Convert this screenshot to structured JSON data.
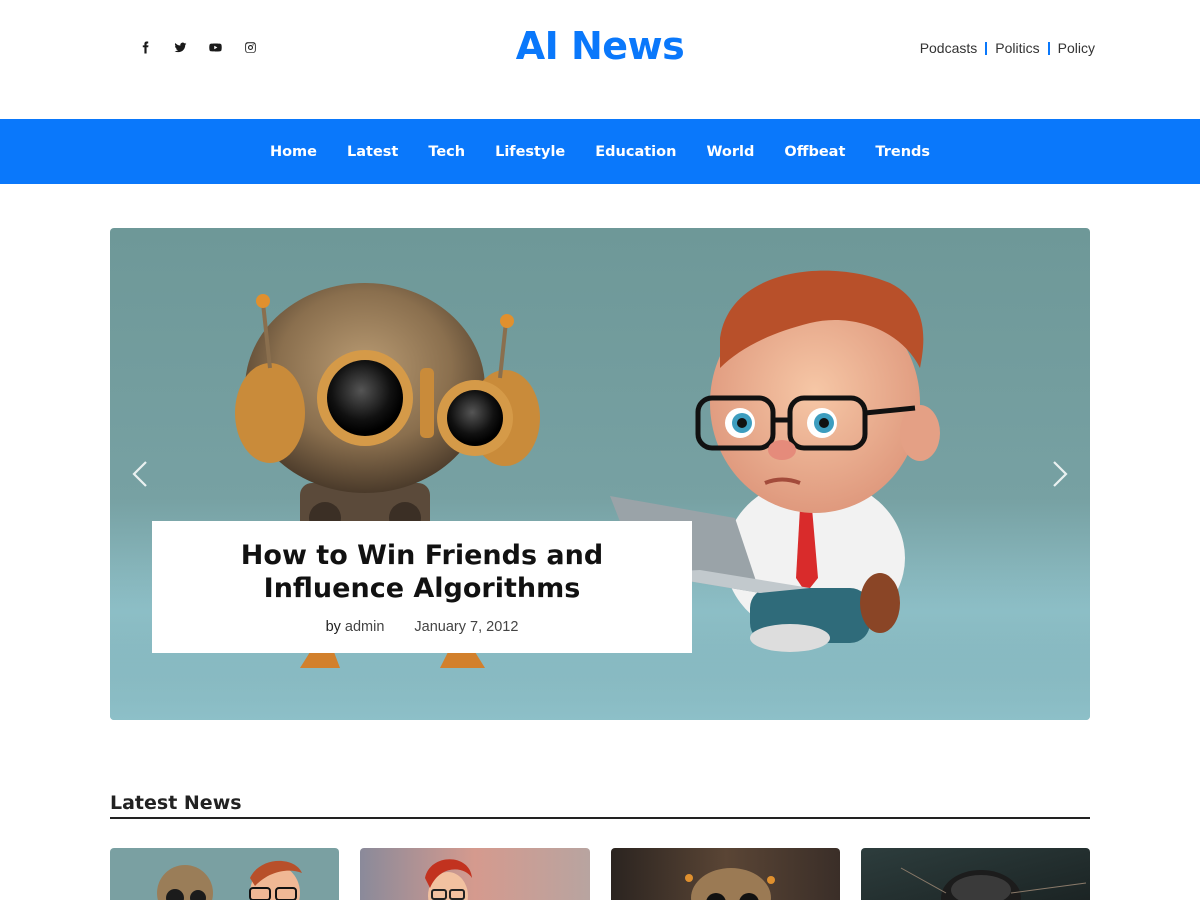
{
  "header": {
    "logo": "AI News",
    "social": [
      {
        "icon": "facebook-icon"
      },
      {
        "icon": "twitter-icon"
      },
      {
        "icon": "youtube-icon"
      },
      {
        "icon": "instagram-icon"
      }
    ],
    "links": [
      "Podcasts",
      "Politics",
      "Policy"
    ],
    "accent_color": "#0a78fb"
  },
  "nav": {
    "items": [
      "Home",
      "Latest",
      "Tech",
      "Lifestyle",
      "Education",
      "World",
      "Offbeat",
      "Trends"
    ]
  },
  "hero": {
    "title": "How to Win Friends and Influence Algorithms",
    "by_prefix": "by",
    "author": "admin",
    "date": "January 7, 2012",
    "prev_icon": "chevron-left-icon",
    "next_icon": "chevron-right-icon"
  },
  "latest": {
    "title": "Latest News"
  }
}
